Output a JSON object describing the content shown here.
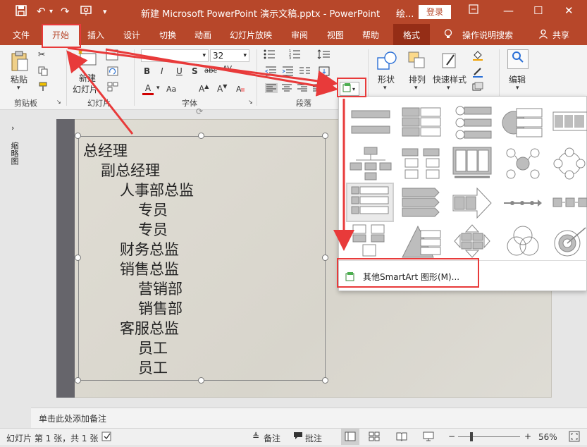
{
  "titlebar": {
    "doc_title": "新建 Microsoft PowerPoint 演示文稿.pptx  -  PowerPoint",
    "context_label": "绘...",
    "login_label": "登录",
    "save_icon": "save-icon",
    "undo_icon": "undo-icon",
    "redo_icon": "redo-icon",
    "present_icon": "present-icon",
    "customize_icon": "customize-qat-icon"
  },
  "tabs": [
    {
      "label": "文件"
    },
    {
      "label": "开始"
    },
    {
      "label": "插入"
    },
    {
      "label": "设计"
    },
    {
      "label": "切换"
    },
    {
      "label": "动画"
    },
    {
      "label": "幻灯片放映"
    },
    {
      "label": "审阅"
    },
    {
      "label": "视图"
    },
    {
      "label": "帮助"
    },
    {
      "label": "格式"
    }
  ],
  "tell_me": "操作说明搜索",
  "share": "共享",
  "ribbon": {
    "clipboard": {
      "paste": "粘贴",
      "group": "剪贴板"
    },
    "slides": {
      "new_slide_line1": "新建",
      "new_slide_line2": "幻灯片",
      "group": "幻灯片"
    },
    "font": {
      "font_name": "",
      "font_size": "32",
      "group": "字体"
    },
    "paragraph": {
      "group": "段落"
    },
    "drawing": {
      "shape": "形状",
      "arrange": "排列",
      "quick_style": "快速样式"
    },
    "editing": {
      "label": "编辑"
    }
  },
  "leftpane": {
    "label": "缩略图"
  },
  "outline": [
    {
      "text": "总经理"
    },
    {
      "text": "副总经理"
    },
    {
      "text": "人事部总监"
    },
    {
      "text": "专员"
    },
    {
      "text": "专员"
    },
    {
      "text": "财务总监"
    },
    {
      "text": "销售总监"
    },
    {
      "text": "营销部"
    },
    {
      "text": "销售部"
    },
    {
      "text": "客服总监"
    },
    {
      "text": "员工"
    },
    {
      "text": "员工"
    }
  ],
  "smartart_menu": {
    "more_label": "其他SmartArt 图形(M)..."
  },
  "notes": {
    "placeholder": "单击此处添加备注"
  },
  "status": {
    "slide_info": "幻灯片 第 1 张，共 1 张",
    "notes_btn": "备注",
    "comments_btn": "批注",
    "zoom": "56%"
  },
  "colors": {
    "accent": "#b7472a",
    "highlight": "#e83a3a"
  }
}
